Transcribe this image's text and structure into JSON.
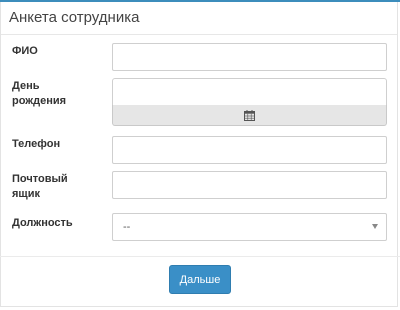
{
  "header": {
    "title": "Анкета сотрудника"
  },
  "form": {
    "fio": {
      "label": "ФИО",
      "value": "",
      "placeholder": ""
    },
    "birthday": {
      "label": "День рождения",
      "value": "",
      "placeholder": "",
      "button_icon": "calendar-icon"
    },
    "phone": {
      "label": "Телефон",
      "value": "",
      "placeholder": ""
    },
    "email": {
      "label": "Почтовый ящик",
      "value": "",
      "placeholder": ""
    },
    "position": {
      "label": "Должность",
      "selected": "--"
    }
  },
  "footer": {
    "next_label": "Дальше"
  },
  "colors": {
    "accent": "#3a8fc7",
    "top_bar": "#3c8dbc"
  }
}
